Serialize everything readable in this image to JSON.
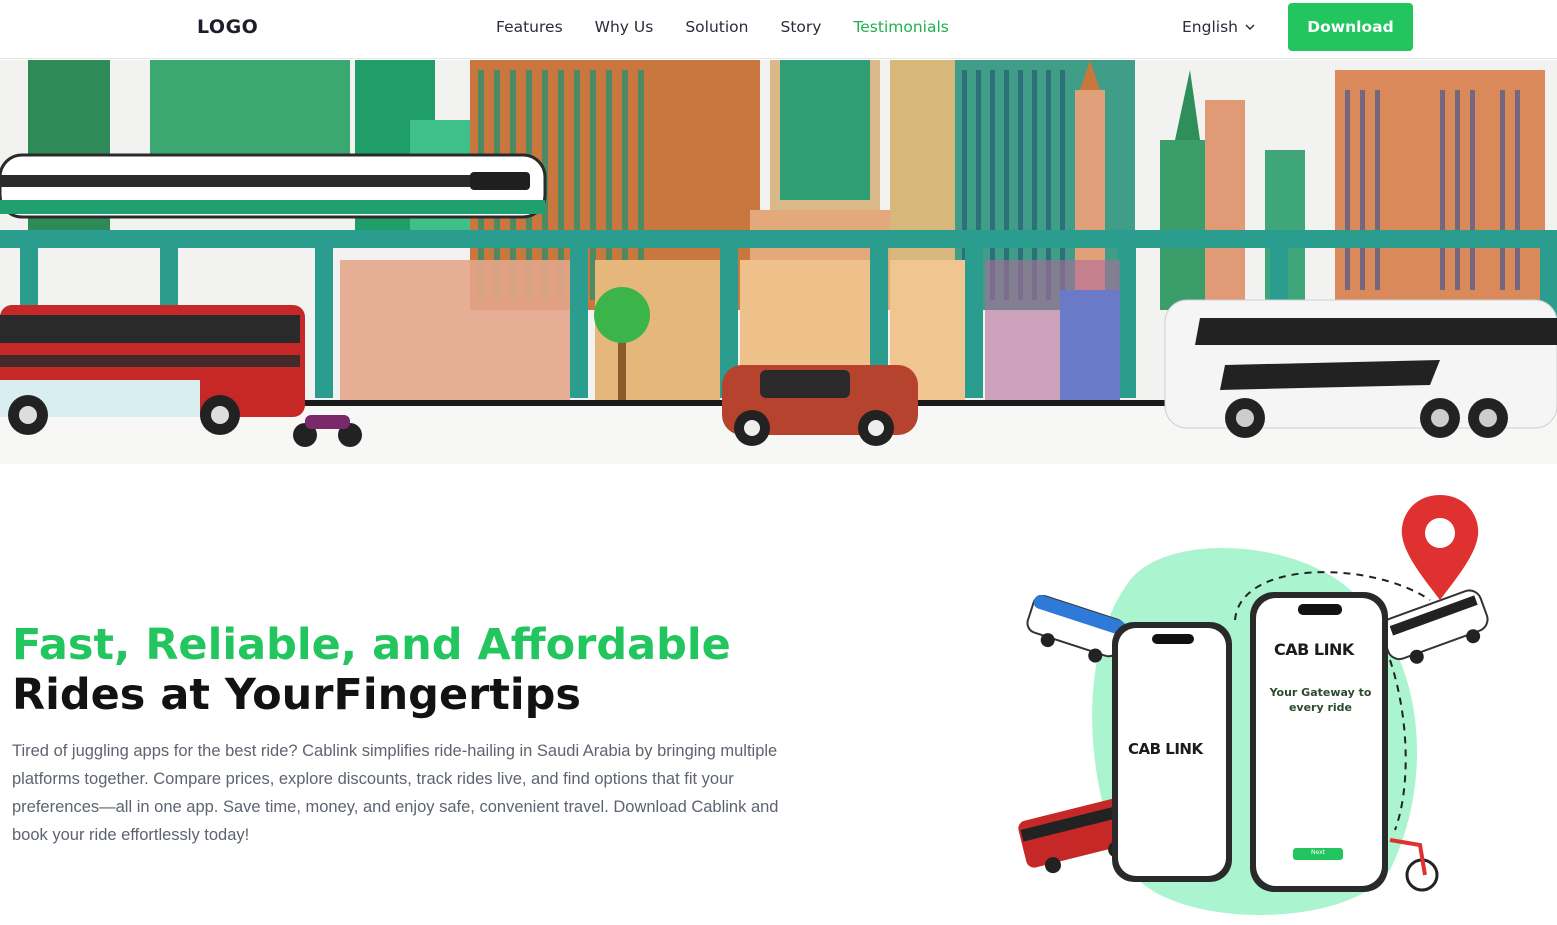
{
  "nav": {
    "logo": "LOGO",
    "links": [
      "Features",
      "Why Us",
      "Solution",
      "Story",
      "Testimonials"
    ],
    "active_link": "Testimonials",
    "language": "English",
    "download_label": "Download"
  },
  "hero": {
    "title_green": "Fast, Reliable, and Affordable",
    "title_dark": "Rides at YourFingertips",
    "description": "Tired of juggling apps for the best ride? Cablink simplifies ride-hailing in Saudi Arabia by bringing multiple platforms together. Compare prices, explore discounts, track rides live, and find options that fit your preferences—all in one app. Save time, money, and enjoy safe, convenient travel. Download Cablink and book your ride effortlessly today!"
  },
  "illustration": {
    "brand": "CAB LINK",
    "tagline_line1": "Your Gateway to",
    "tagline_line2": "every ride",
    "next_label": "Next"
  },
  "colors": {
    "accent": "#22c55e",
    "teal": "#2a9d8f",
    "bus_red": "#c62828"
  }
}
